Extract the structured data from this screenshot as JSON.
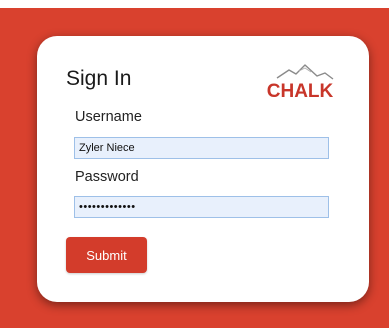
{
  "login": {
    "title": "Sign In",
    "logo_text": "CHALK",
    "username_label": "Username",
    "username_value": "Zyler Niece",
    "password_label": "Password",
    "password_value": "•••••••••••••",
    "submit_label": "Submit"
  },
  "colors": {
    "background": "#d9412e",
    "accent": "#d33c2b",
    "field_bg": "#e8f0fc"
  }
}
